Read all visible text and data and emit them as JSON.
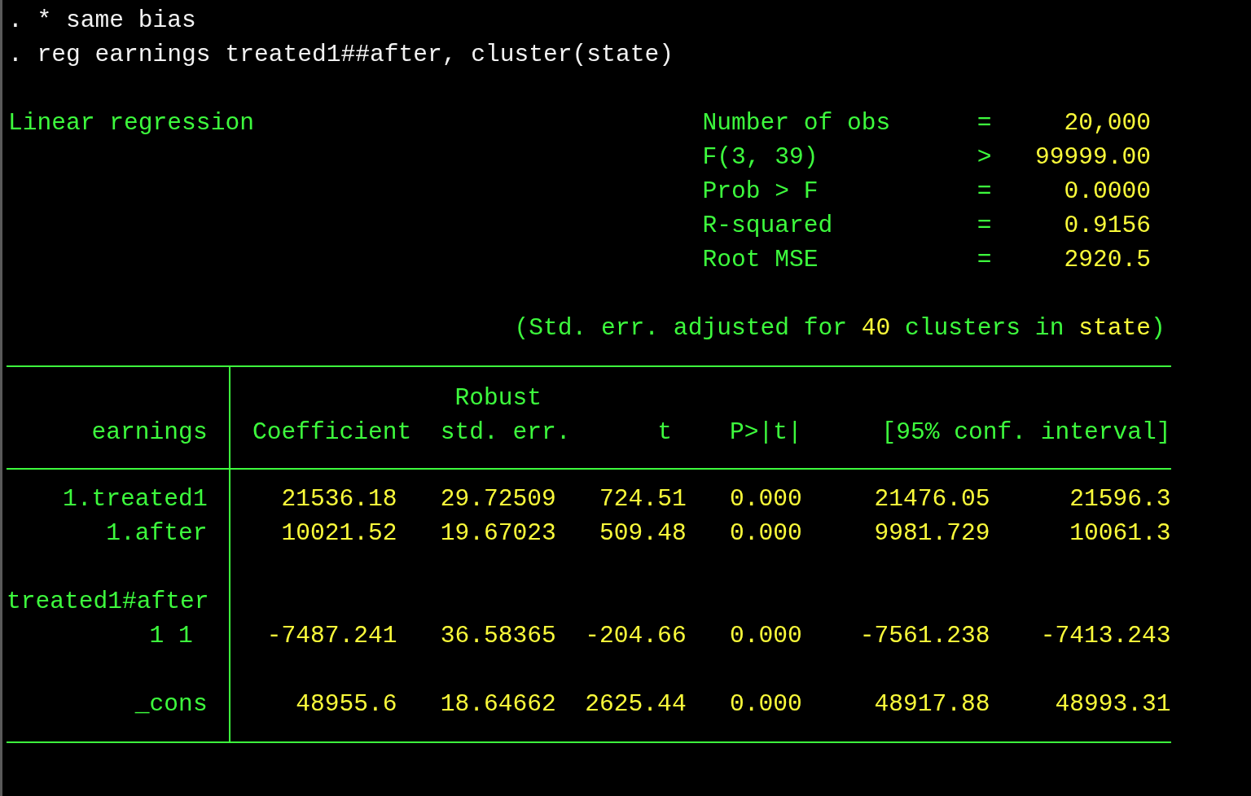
{
  "commands": [
    {
      "prompt": ".",
      "text": "* same bias"
    },
    {
      "prompt": ".",
      "text": "reg earnings treated1##after, cluster(state)"
    }
  ],
  "output_title": "Linear regression",
  "stats": [
    {
      "label": "Number of obs",
      "operator": "=",
      "value": "20,000"
    },
    {
      "label": "F(3, 39)",
      "operator": ">",
      "value": "99999.00"
    },
    {
      "label": "Prob > F",
      "operator": "=",
      "value": "0.0000"
    },
    {
      "label": "R-squared",
      "operator": "=",
      "value": "0.9156"
    },
    {
      "label": "Root MSE",
      "operator": "=",
      "value": "2920.5"
    }
  ],
  "note": [
    {
      "text": "(Std. err. adjusted for ",
      "kind": "label"
    },
    {
      "text": "40",
      "kind": "value"
    },
    {
      "text": " clusters in ",
      "kind": "label"
    },
    {
      "text": "state",
      "kind": "value"
    },
    {
      "text": ")",
      "kind": "label"
    }
  ],
  "table": {
    "header_above": "Robust",
    "depvar": "earnings",
    "columns": [
      "Coefficient",
      "std. err.",
      "t",
      "P>|t|",
      "[95% conf. interval]"
    ],
    "rows": [
      {
        "kind": "coef",
        "label": "1.treated1",
        "values": [
          "21536.18",
          "29.72509",
          "724.51",
          "0.000",
          "21476.05",
          "21596.3"
        ]
      },
      {
        "kind": "coef",
        "label": "1.after",
        "values": [
          "10021.52",
          "19.67023",
          "509.48",
          "0.000",
          "9981.729",
          "10061.3"
        ]
      },
      {
        "kind": "group",
        "label": "treated1#after"
      },
      {
        "kind": "level",
        "label": "1 1",
        "values": [
          "-7487.241",
          "36.58365",
          "-204.66",
          "0.000",
          "-7561.238",
          "-7413.243"
        ]
      },
      {
        "kind": "constant",
        "label": "_cons",
        "values": [
          "48955.6",
          "18.64662",
          "2625.44",
          "0.000",
          "48917.88",
          "48993.31"
        ]
      }
    ]
  }
}
